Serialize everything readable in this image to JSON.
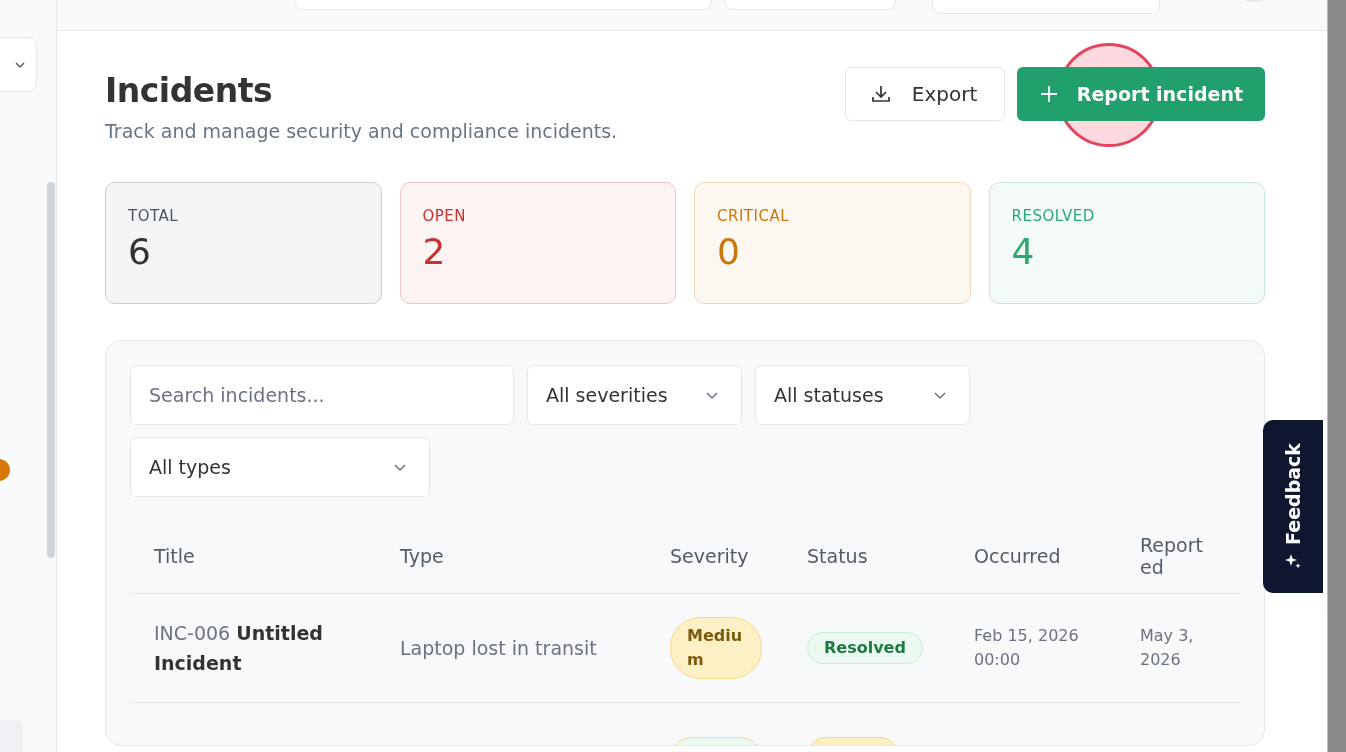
{
  "page": {
    "title": "Incidents",
    "subtitle": "Track and manage security and compliance incidents."
  },
  "actions": [
    {
      "kind": "export",
      "label": "Export"
    },
    {
      "kind": "primary",
      "label": "Report incident"
    }
  ],
  "stats": [
    {
      "label": "TOTAL",
      "value": "6",
      "color": "#4b5563"
    },
    {
      "label": "OPEN",
      "value": "2",
      "color": "#c5322f"
    },
    {
      "label": "CRITICAL",
      "value": "0",
      "color": "#c9780d"
    },
    {
      "label": "RESOLVED",
      "value": "4",
      "color": "#2fa874"
    }
  ],
  "filters": [
    {
      "kind": "search",
      "placeholder": "Search incidents..."
    },
    {
      "kind": "select",
      "value": "All severities"
    },
    {
      "kind": "select",
      "value": "All statuses"
    },
    {
      "kind": "select",
      "value": "All types"
    }
  ],
  "table": {
    "columns": [
      "Title",
      "Type",
      "Severity",
      "Status",
      "Occurred",
      "Reported"
    ],
    "rows": [
      {
        "id": "INC-006",
        "title": "Untitled Incident",
        "type": "Laptop lost in transit",
        "severity": {
          "label": "Medium",
          "color": "#fdf0c4"
        },
        "status": {
          "label": "Resolved",
          "color": "#ecfbf1"
        },
        "occurred": "Feb 15, 2026 00:00",
        "reported": "May 3, 2026"
      },
      {
        "severity": {
          "color": "#ecfbf1"
        },
        "status": {
          "color": "#fdf0c4"
        }
      }
    ]
  },
  "feedback": {
    "label": "Feedback"
  }
}
